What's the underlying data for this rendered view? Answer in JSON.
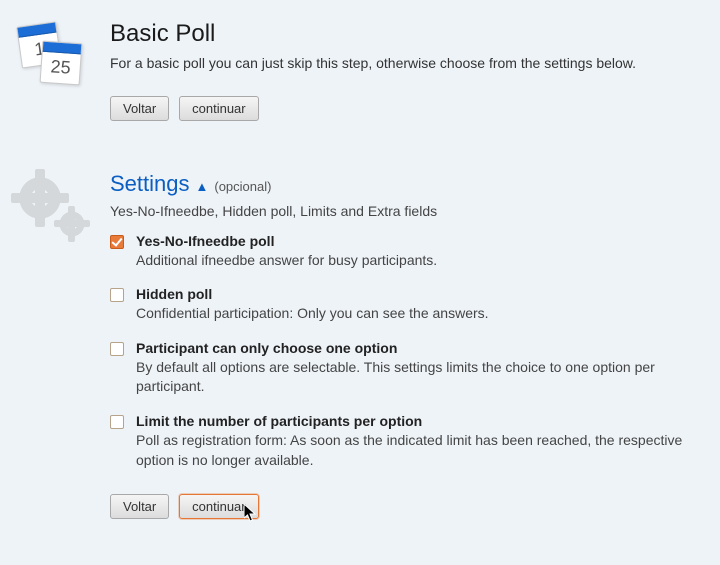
{
  "basic": {
    "title": "Basic Poll",
    "desc": "For a basic poll you can just skip this step, otherwise choose from the settings below.",
    "back": "Voltar",
    "continue": "continuar"
  },
  "calendar": {
    "num_back": "1",
    "num_front": "25"
  },
  "settings": {
    "title": "Settings",
    "optional": "(opcional)",
    "subdesc": "Yes-No-Ifneedbe, Hidden poll, Limits and Extra fields",
    "options": [
      {
        "checked": true,
        "title": "Yes-No-Ifneedbe poll",
        "desc": "Additional ifneedbe answer for busy participants."
      },
      {
        "checked": false,
        "title": "Hidden poll",
        "desc": "Confidential participation: Only you can see the answers."
      },
      {
        "checked": false,
        "title": "Participant can only choose one option",
        "desc": "By default all options are selectable. This settings limits the choice to one option per participant."
      },
      {
        "checked": false,
        "title": "Limit the number of participants per option",
        "desc": "Poll as registration form: As soon as the indicated limit has been reached, the respective option is no longer available."
      }
    ],
    "back": "Voltar",
    "continue": "continuar"
  }
}
